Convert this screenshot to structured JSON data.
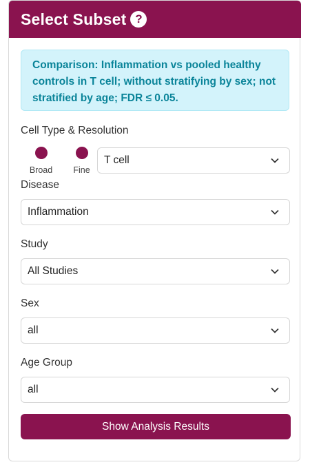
{
  "header": {
    "title": "Select Subset",
    "help_icon": "question-circle-icon"
  },
  "alert": {
    "text": "Comparison: Inflammation vs pooled healthy controls in T cell; without stratifying by sex; not stratified by age; FDR ≤ 0.05."
  },
  "cell_type": {
    "label": "Cell Type & Resolution",
    "options": [
      {
        "label": "Broad"
      },
      {
        "label": "Fine"
      }
    ],
    "selected_value": "T cell"
  },
  "disease": {
    "label": "Disease",
    "value": "Inflammation"
  },
  "study": {
    "label": "Study",
    "value": "All Studies"
  },
  "sex": {
    "label": "Sex",
    "value": "all"
  },
  "age_group": {
    "label": "Age Group",
    "value": "all"
  },
  "submit": {
    "label": "Show Analysis Results"
  },
  "colors": {
    "primary": "#8a134f",
    "alert_bg": "#d3f3fb",
    "alert_text": "#0a8499"
  }
}
